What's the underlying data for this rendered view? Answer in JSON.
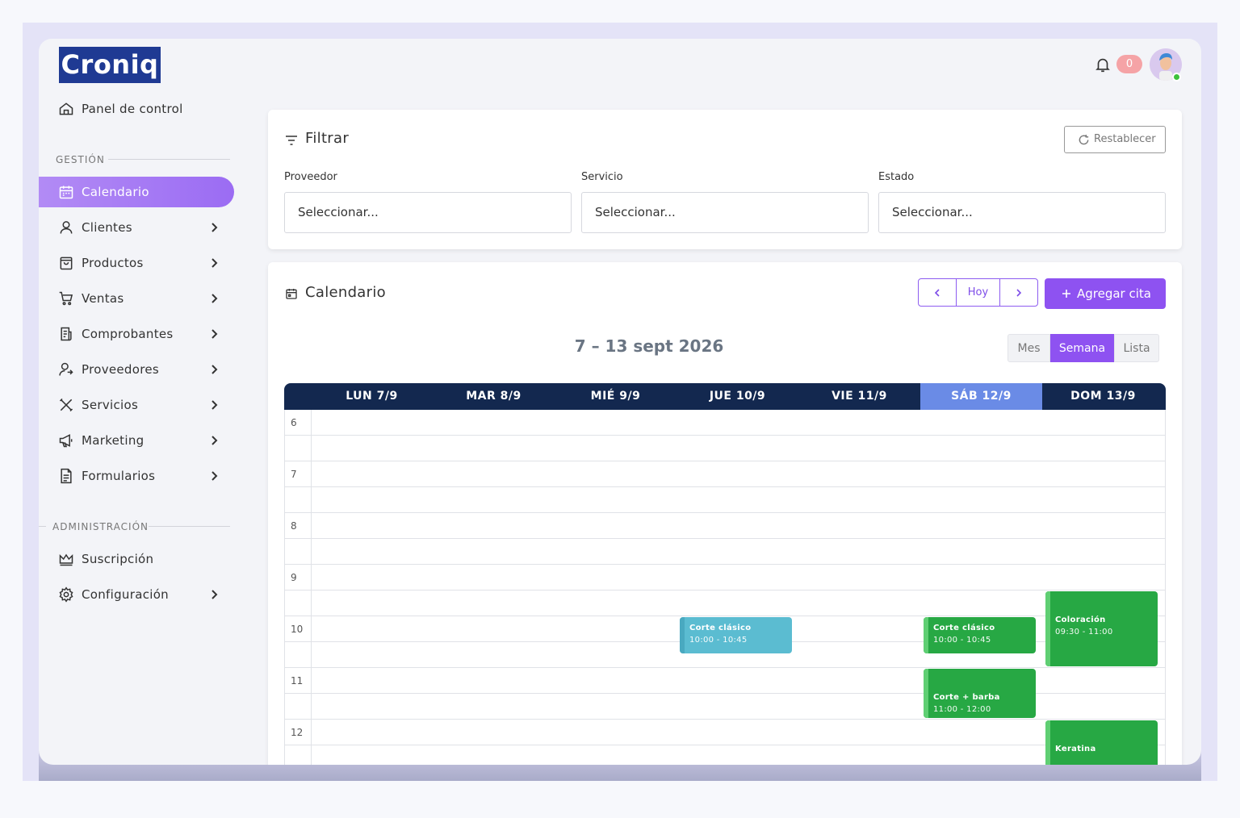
{
  "brand": {
    "logo_text": "Croniq",
    "logo_color": "#1f3a93"
  },
  "header": {
    "notification_count": "0",
    "avatar": "user-avatar"
  },
  "sidebar": {
    "dashboard": "Panel de control",
    "section_gestion": "GESTIÓN",
    "items": [
      {
        "label": "Calendario",
        "icon": "calendar-icon",
        "active": true
      },
      {
        "label": "Clientes",
        "icon": "user-icon"
      },
      {
        "label": "Productos",
        "icon": "bag-icon"
      },
      {
        "label": "Ventas",
        "icon": "cart-icon"
      },
      {
        "label": "Comprobantes",
        "icon": "receipt-icon"
      },
      {
        "label": "Proveedores",
        "icon": "supplier-icon"
      },
      {
        "label": "Servicios",
        "icon": "tools-icon"
      },
      {
        "label": "Marketing",
        "icon": "megaphone-icon"
      },
      {
        "label": "Formularios",
        "icon": "form-icon"
      }
    ],
    "section_admin": "ADMINISTRACIÓN",
    "admin_items": [
      {
        "label": "Suscripción",
        "icon": "crown-icon"
      },
      {
        "label": "Configuración",
        "icon": "gear-icon"
      }
    ]
  },
  "filter": {
    "title": "Filtrar",
    "reset_label": "Restablecer",
    "fields": [
      {
        "label": "Proveedor",
        "value": "Seleccionar..."
      },
      {
        "label": "Servicio",
        "value": "Seleccionar..."
      },
      {
        "label": "Estado",
        "value": "Seleccionar..."
      }
    ]
  },
  "calendar": {
    "title": "Calendario",
    "today_label": "Hoy",
    "add_label": "Agregar cita",
    "range": "7 – 13 sept 2026",
    "views": [
      "Mes",
      "Semana",
      "Lista"
    ],
    "active_view": "Semana",
    "days": [
      "LUN 7/9",
      "MAR 8/9",
      "MIÉ 9/9",
      "JUE 10/9",
      "VIE 11/9",
      "SÁB 12/9",
      "DOM 13/9"
    ],
    "today_index": 5,
    "hours": [
      "6",
      "7",
      "8",
      "9",
      "10",
      "11",
      "12"
    ],
    "events": [
      {
        "title": "Corte clásico",
        "time": "10:00 - 10:45",
        "day": 3,
        "start": 10.0,
        "end": 10.75,
        "color": "#5bbcd1",
        "bar": "#49a9c0"
      },
      {
        "title": "Corte clásico",
        "time": "10:00 - 10:45",
        "day": 5,
        "start": 10.0,
        "end": 10.75,
        "color": "#27a844",
        "bar": "#5fcf73"
      },
      {
        "title": "Coloración",
        "time": "09:30 - 11:00",
        "day": 6,
        "start": 9.5,
        "end": 11.0,
        "color": "#27a844",
        "bar": "#5fcf73"
      },
      {
        "title": "Corte + barba",
        "time": "11:00 - 12:00",
        "day": 5,
        "start": 11.0,
        "end": 12.0,
        "color": "#27a844",
        "bar": "#5fcf73"
      },
      {
        "title": "Keratina",
        "time": "",
        "day": 6,
        "start": 12.0,
        "end": 13.5,
        "color": "#27a844",
        "bar": "#5fcf73"
      }
    ]
  }
}
